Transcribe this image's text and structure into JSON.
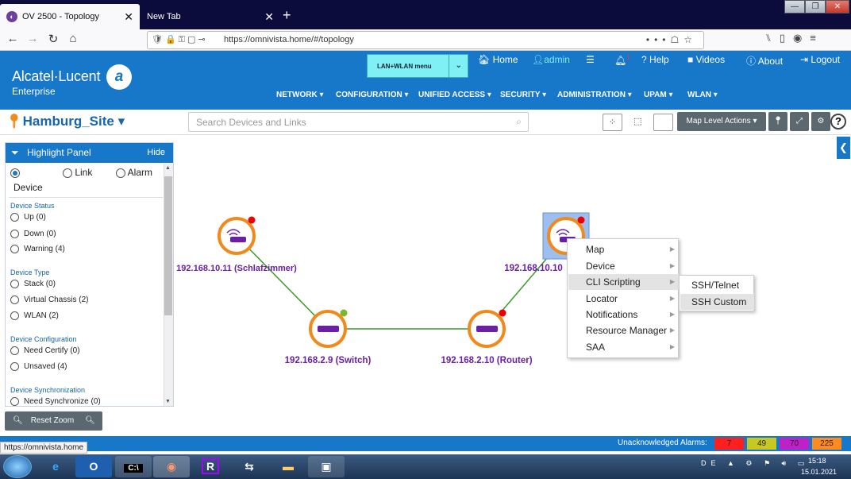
{
  "browser": {
    "tabs": [
      {
        "title": "OV 2500 - Topology",
        "active": true
      },
      {
        "title": "New Tab",
        "active": false
      }
    ],
    "url": "https://omnivista.home/#/topology",
    "window_controls": [
      "—",
      "❐",
      "✕"
    ]
  },
  "header": {
    "brand": "Alcatel·Lucent",
    "brand_sub": "Enterprise",
    "menu_button": "LAN+WLAN menu",
    "links": [
      "Home",
      "admin",
      "Help",
      "Videos",
      "About",
      "Logout"
    ],
    "notification_count": "1",
    "nav": [
      "NETWORK",
      "CONFIGURATION",
      "UNIFIED ACCESS",
      "SECURITY",
      "ADMINISTRATION",
      "UPAM",
      "WLAN"
    ]
  },
  "sitebar": {
    "site_name": "Hamburg_Site",
    "search_placeholder": "Search Devices and Links",
    "map_actions": "Map Level Actions",
    "help": "?"
  },
  "highlight_panel": {
    "title": "Highlight Panel",
    "hide": "Hide",
    "modes": [
      "Device",
      "Link",
      "Alarm"
    ],
    "sections": [
      {
        "title": "Device Status",
        "options": [
          "Up (0)",
          "Down (0)",
          "Warning (4)"
        ]
      },
      {
        "title": "Device Type",
        "options": [
          "Stack (0)",
          "Virtual Chassis (2)",
          "WLAN (2)"
        ]
      },
      {
        "title": "Device Configuration",
        "options": [
          "Need Certify (0)",
          "Unsaved (4)"
        ]
      },
      {
        "title": "Device Synchronization",
        "options": [
          "Need Synchronize (0)"
        ]
      }
    ],
    "reset_zoom": "Reset Zoom"
  },
  "topology": {
    "devices": [
      {
        "label": "192.168.10.11 (Schlafzimmer)",
        "kind": "wlan",
        "status": "red"
      },
      {
        "label": "192.168.2.9 (Switch)",
        "kind": "switch",
        "status": "green"
      },
      {
        "label": "192.168.2.10 (Router)",
        "kind": "switch",
        "status": "red"
      },
      {
        "label": "192.168.10.10",
        "kind": "wlan",
        "status": "red",
        "selected": true
      }
    ],
    "links": [
      {
        "from": "192.168.10.11 (Schlafzimmer)",
        "to": "192.168.2.9 (Switch)"
      },
      {
        "from": "192.168.2.9 (Switch)",
        "to": "192.168.2.10 (Router)"
      },
      {
        "from": "192.168.2.10 (Router)",
        "to": "192.168.10.10"
      }
    ]
  },
  "context_menu": {
    "items": [
      "Map",
      "Device",
      "CLI Scripting",
      "Locator",
      "Notifications",
      "Resource Manager",
      "SAA"
    ],
    "highlighted": "CLI Scripting",
    "submenu": [
      "SSH/Telnet",
      "SSH Custom"
    ],
    "submenu_highlighted": "SSH Custom"
  },
  "status_bar": {
    "label": "Unacknowledged Alarms:",
    "alarms": [
      {
        "value": "7",
        "color": "#ff1f1f"
      },
      {
        "value": "49",
        "color": "#c8c820"
      },
      {
        "value": "70",
        "color": "#c020c8"
      },
      {
        "value": "225",
        "color": "#ff8a20"
      }
    ],
    "hover_url": "https://omnivista.home"
  },
  "taskbar": {
    "language": "DE",
    "time": "15:18",
    "date": "15.01.2021"
  }
}
